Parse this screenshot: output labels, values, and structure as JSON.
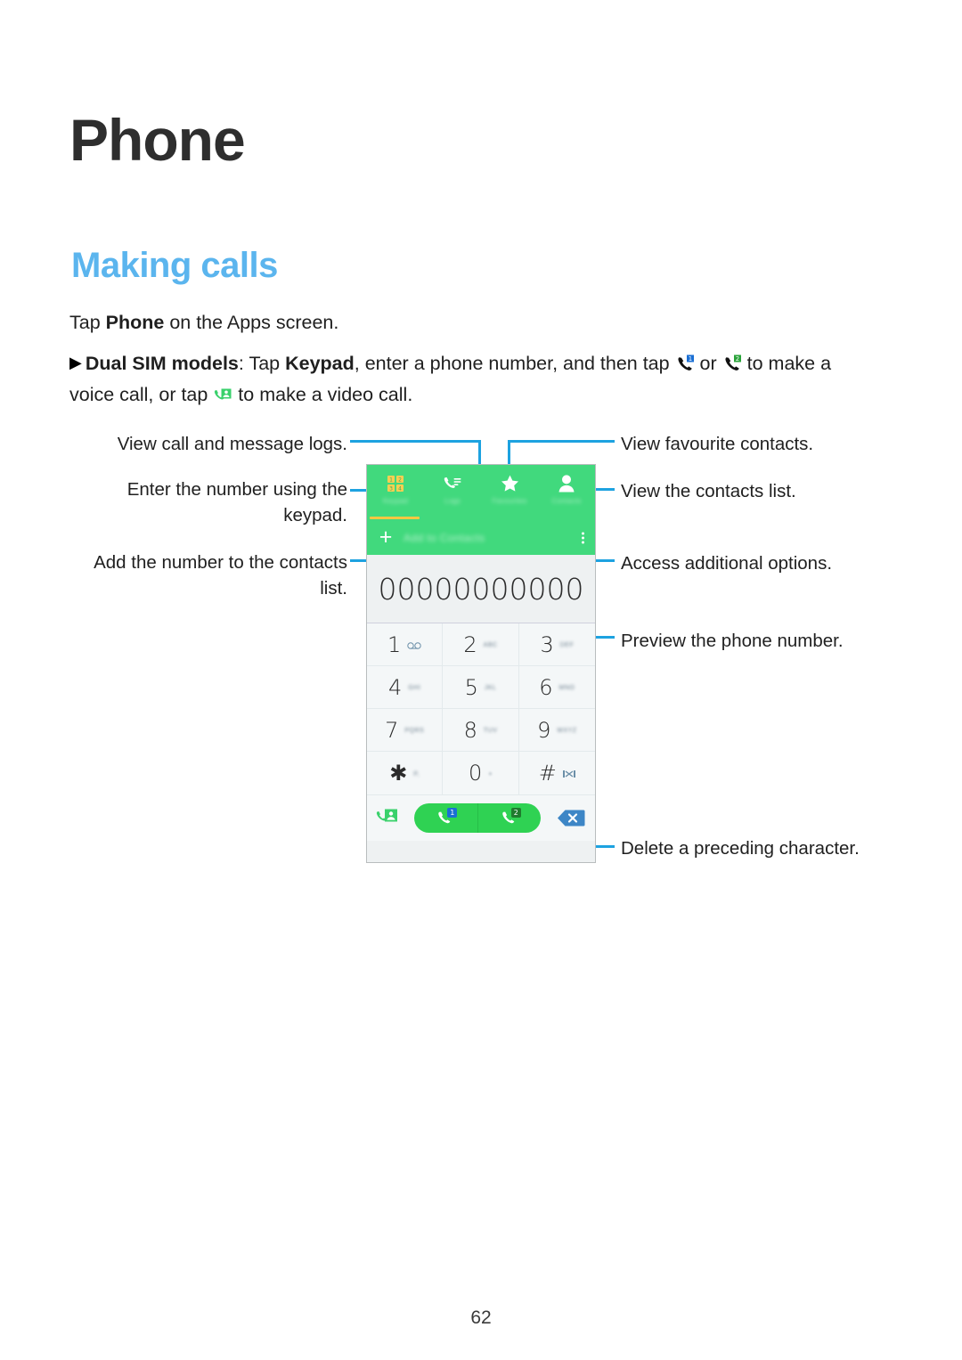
{
  "page": {
    "chapter_title": "Phone",
    "section_title": "Making calls",
    "page_number": "62"
  },
  "body": {
    "line1_pre": "Tap ",
    "line1_bold": "Phone",
    "line1_post": " on the Apps screen.",
    "bullet_marker": "▶",
    "bullet_bold1": "Dual SIM models",
    "bullet_t1": ": Tap ",
    "bullet_bold2": "Keypad",
    "bullet_t2": ", enter a phone number, and then tap ",
    "bullet_t3": " or ",
    "bullet_t4": " to make a voice call, or tap ",
    "bullet_t5": " to make a video call."
  },
  "callouts": {
    "left": [
      {
        "id": "logs",
        "text": "View call and message logs."
      },
      {
        "id": "keypad",
        "text": "Enter the number using the\nkeypad."
      },
      {
        "id": "add-contact",
        "text": "Add the number to the contacts\nlist."
      }
    ],
    "right": [
      {
        "id": "favourites",
        "text": "View favourite contacts."
      },
      {
        "id": "contacts",
        "text": "View the contacts list."
      },
      {
        "id": "more-options",
        "text": "Access additional options."
      },
      {
        "id": "preview-number",
        "text": "Preview the phone number."
      },
      {
        "id": "backspace",
        "text": "Delete a preceding character."
      }
    ]
  },
  "screenshot": {
    "tabs": [
      {
        "name": "keypad",
        "label": "Keypad",
        "icon": "keypad-grid-icon",
        "selected": true
      },
      {
        "name": "logs",
        "label": "Logs",
        "icon": "call-logs-icon",
        "selected": false
      },
      {
        "name": "favourites",
        "label": "Favourites",
        "icon": "star-icon",
        "selected": false
      },
      {
        "name": "contacts",
        "label": "Contacts",
        "icon": "person-icon",
        "selected": false
      }
    ],
    "add_row": {
      "plus": "+",
      "label": "Add to Contacts",
      "overflow_icon": "more-vertical-icon"
    },
    "number_display": "00000000000",
    "keys": [
      {
        "digit": "1",
        "sub": "",
        "icon": "voicemail-icon"
      },
      {
        "digit": "2",
        "sub": "ABC",
        "icon": ""
      },
      {
        "digit": "3",
        "sub": "DEF",
        "icon": ""
      },
      {
        "digit": "4",
        "sub": "GHI",
        "icon": ""
      },
      {
        "digit": "5",
        "sub": "JKL",
        "icon": ""
      },
      {
        "digit": "6",
        "sub": "MNO",
        "icon": ""
      },
      {
        "digit": "7",
        "sub": "PQRS",
        "icon": ""
      },
      {
        "digit": "8",
        "sub": "TUV",
        "icon": ""
      },
      {
        "digit": "9",
        "sub": "WXYZ",
        "icon": ""
      },
      {
        "digit": "✱",
        "sub": "P,",
        "icon": ""
      },
      {
        "digit": "0",
        "sub": "+",
        "icon": ""
      },
      {
        "digit": "#",
        "sub": "",
        "icon": "pause-wait-icon"
      }
    ],
    "actions": {
      "video_call_icon": "video-call-icon",
      "call_sim1_label": "1",
      "call_sim2_label": "2",
      "backspace_icon": "backspace-icon"
    }
  },
  "colors": {
    "accent_blue": "#5bb5ee",
    "line_blue": "#1da2e0",
    "header_green": "#41d97d",
    "call_green": "#2fd253",
    "tab_underline_yellow": "#f5c842",
    "keypad_icon_yellow": "#f5c842",
    "sim1_blue": "#1a6fd4",
    "sim2_green": "#1f7a2e",
    "text_black": "#1f1f1f"
  }
}
